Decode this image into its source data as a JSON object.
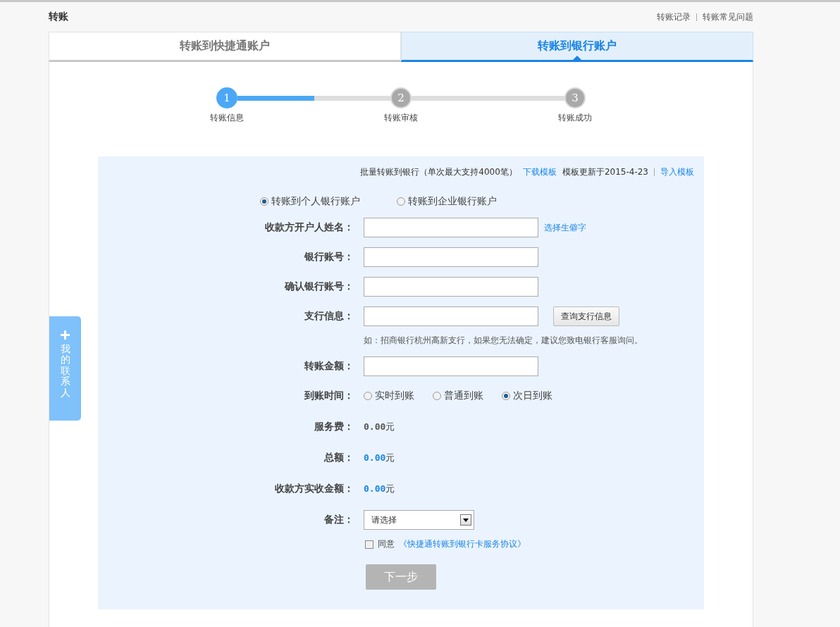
{
  "header": {
    "title": "转账",
    "links": [
      "转账记录",
      "转账常见问题"
    ]
  },
  "tabs": [
    {
      "label": "转账到快捷通账户",
      "selected": false
    },
    {
      "label": "转账到银行账户",
      "selected": true
    }
  ],
  "steps": {
    "connectors": [
      {
        "level": 0.5
      }
    ],
    "items": [
      {
        "number": "1",
        "label": "转账信息",
        "active": true
      },
      {
        "number": "2",
        "label": "转账审核",
        "active": false
      },
      {
        "number": "3",
        "label": "转账成功",
        "active": false
      }
    ]
  },
  "batch": {
    "text": "批量转账到银行（单次最大支持4000笔）",
    "download": "下载模板",
    "updated": "模板更新于2015-4-23",
    "import": "导入模板"
  },
  "account_types": [
    {
      "label": "转账到个人银行账户",
      "selected": true
    },
    {
      "label": "转账到企业银行账户",
      "selected": false
    }
  ],
  "rows": [
    {
      "kind": "input",
      "label": "收款方开户人姓名：",
      "link": "选择生僻字"
    },
    {
      "kind": "input",
      "label": "银行账号："
    },
    {
      "kind": "input",
      "label": "确认银行账号："
    },
    {
      "kind": "input",
      "label": "支行信息：",
      "button": "查询支行信息",
      "hint": "如：招商银行杭州高新支行，如果您无法确定，建议您致电银行客服询问。"
    },
    {
      "kind": "input",
      "label": "转账金额："
    },
    {
      "kind": "radio",
      "label": "到账时间：",
      "options": [
        {
          "label": "实时到账",
          "selected": false
        },
        {
          "label": "普通到账",
          "selected": false
        },
        {
          "label": "次日到账",
          "selected": true
        }
      ]
    },
    {
      "kind": "amount",
      "label": "服务费：",
      "value": "0.00",
      "unit": "元",
      "highlight": false
    },
    {
      "kind": "amount",
      "label": "总额：",
      "value": "0.00",
      "unit": "元",
      "highlight": true
    },
    {
      "kind": "amount",
      "label": "收款方实收金额：",
      "value": "0.00",
      "unit": "元",
      "highlight": true
    },
    {
      "kind": "select",
      "label": "备注：",
      "value": "请选择"
    }
  ],
  "agreement": {
    "checked": false,
    "text": "同意",
    "link": "《快捷通转账到银行卡服务协议》"
  },
  "submit": {
    "label": "下一步",
    "disabled": true
  },
  "contacts_tab": {
    "label": "我的联系人"
  }
}
